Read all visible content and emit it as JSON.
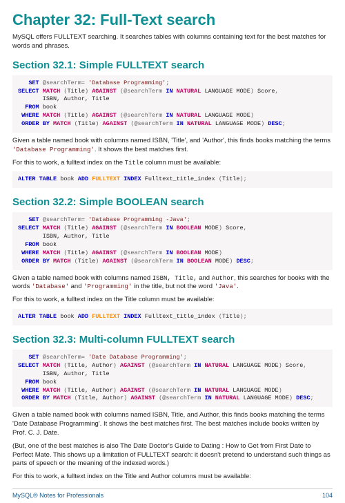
{
  "chapter": {
    "title": "Chapter 32: Full-Text search"
  },
  "intro": "MySQL offers FULLTEXT searching. It searches tables with columns containing text for the best matches for words and phrases.",
  "s1": {
    "title": "Section 32.1: Simple FULLTEXT search",
    "code": {
      "searchTerm": "'Database Programming'",
      "score": "Score",
      "cols": "ISBN, Author, Title",
      "table": "book",
      "mode": "LANGUAGE MODE",
      "idxName": "Fulltext_title_index",
      "idxCol": "Title"
    },
    "p1_a": "Given a table named book with columns named ISBN, 'Title', and 'Author', this finds books matching the terms ",
    "p1_term": "'Database Programming'",
    "p1_b": ". It shows the best matches first.",
    "p2_a": "For this to work, a fulltext index on the ",
    "p2_col": "Title",
    "p2_b": " column must be available:"
  },
  "s2": {
    "title": "Section 32.2: Simple BOOLEAN search",
    "code": {
      "searchTerm": "'Database Programming -Java'",
      "score": "Score",
      "cols": "ISBN, Author, Title",
      "table": "book",
      "mode": "MODE",
      "idxName": "Fulltext_title_index",
      "idxCol": "Title"
    },
    "p1_a": "Given a table named book with columns named ",
    "p1_cols": "ISBN, Title,",
    "p1_b": " and ",
    "p1_auth": "Author",
    "p1_c": ", this searches for books with the words ",
    "p1_w1": "'Database'",
    "p1_and": " and ",
    "p1_w2": "'Programming'",
    "p1_d": " in the title, but not the word ",
    "p1_w3": "'Java'",
    "p1_e": ".",
    "p2": "For this to work, a fulltext index on the Title column must be available:"
  },
  "s3": {
    "title": "Section 32.3: Multi-column FULLTEXT search",
    "code": {
      "searchTerm": "'Date Database Programming'",
      "matchCols": "Title, Author",
      "score": "Score",
      "cols": "ISBN, Author, Title",
      "table": "book",
      "mode": "LANGUAGE MODE"
    },
    "p1": "Given a table named book with columns named ISBN, Title, and Author, this finds books matching the terms 'Date Database Programming'. It shows the best matches first. The best matches include books written by Prof. C. J. Date.",
    "p2": "(But, one of the best matches is also The Date Doctor's Guide to Dating : How to Get from First Date to Perfect Mate. This shows up a limitation of FULLTEXT search: it doesn't pretend to understand such things as parts of speech or the meaning of the indexed words.)",
    "p3": "For this to work, a fulltext index on the Title and Author columns must be available:"
  },
  "footer": {
    "left": "MySQL® Notes for Professionals",
    "right": "104"
  }
}
